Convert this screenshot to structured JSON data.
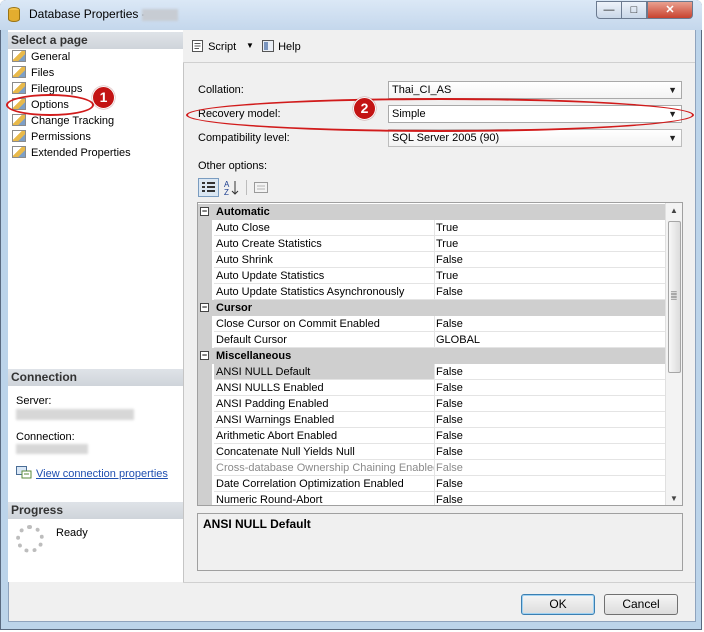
{
  "window": {
    "title": "Database Properties -"
  },
  "caption": {
    "minimize": "—",
    "maximize": "□",
    "close": "✕"
  },
  "left": {
    "select_page_header": "Select a page",
    "pages": [
      "General",
      "Files",
      "Filegroups",
      "Options",
      "Change Tracking",
      "Permissions",
      "Extended Properties"
    ],
    "connection_header": "Connection",
    "server_label": "Server:",
    "connection_label": "Connection:",
    "view_connection_link": "View connection properties",
    "progress_header": "Progress",
    "progress_status": "Ready"
  },
  "toolbar": {
    "script_label": "Script",
    "help_label": "Help"
  },
  "form": {
    "collation_label": "Collation:",
    "collation_value": "Thai_CI_AS",
    "recovery_label": "Recovery model:",
    "recovery_value": "Simple",
    "compat_label": "Compatibility level:",
    "compat_value": "SQL Server 2005 (90)",
    "other_options_label": "Other options:"
  },
  "grid": {
    "rows": [
      {
        "kind": "cat",
        "name": "Automatic"
      },
      {
        "kind": "prop",
        "name": "Auto Close",
        "value": "True"
      },
      {
        "kind": "prop",
        "name": "Auto Create Statistics",
        "value": "True"
      },
      {
        "kind": "prop",
        "name": "Auto Shrink",
        "value": "False"
      },
      {
        "kind": "prop",
        "name": "Auto Update Statistics",
        "value": "True"
      },
      {
        "kind": "prop",
        "name": "Auto Update Statistics Asynchronously",
        "value": "False"
      },
      {
        "kind": "cat",
        "name": "Cursor"
      },
      {
        "kind": "prop",
        "name": "Close Cursor on Commit Enabled",
        "value": "False"
      },
      {
        "kind": "prop",
        "name": "Default Cursor",
        "value": "GLOBAL"
      },
      {
        "kind": "cat",
        "name": "Miscellaneous"
      },
      {
        "kind": "prop",
        "name": "ANSI NULL Default",
        "value": "False",
        "selected": true
      },
      {
        "kind": "prop",
        "name": "ANSI NULLS Enabled",
        "value": "False"
      },
      {
        "kind": "prop",
        "name": "ANSI Padding Enabled",
        "value": "False"
      },
      {
        "kind": "prop",
        "name": "ANSI Warnings Enabled",
        "value": "False"
      },
      {
        "kind": "prop",
        "name": "Arithmetic Abort Enabled",
        "value": "False"
      },
      {
        "kind": "prop",
        "name": "Concatenate Null Yields Null",
        "value": "False"
      },
      {
        "kind": "prop",
        "name": "Cross-database Ownership Chaining Enabled",
        "value": "False",
        "disabled": true
      },
      {
        "kind": "prop",
        "name": "Date Correlation Optimization Enabled",
        "value": "False"
      },
      {
        "kind": "prop",
        "name": "Numeric Round-Abort",
        "value": "False"
      }
    ],
    "description_title": "ANSI NULL Default"
  },
  "buttons": {
    "ok": "OK",
    "cancel": "Cancel"
  },
  "annotations": {
    "badge1": "1",
    "badge2": "2",
    "color": "#d11b1b"
  }
}
